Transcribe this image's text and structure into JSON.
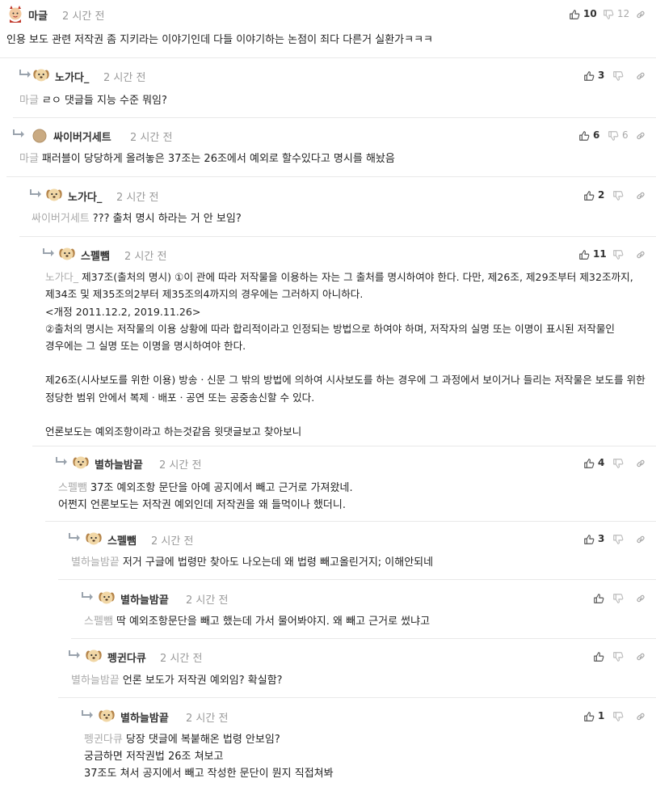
{
  "comments": [
    {
      "author": "마글",
      "time": "2 시간 전",
      "mention": "",
      "lines": [
        "인용 보도 관련 저작권 좀 지키라는 이야기인데 다들 이야기하는 논점이 죄다 다른거 실환가ㅋㅋㅋ"
      ],
      "up": "10",
      "down": "12",
      "avatar": "devil-avatar-icon"
    },
    {
      "author": "노가다_",
      "time": "2 시간 전",
      "mention": "마글",
      "lines": [
        "ㄹㅇ 댓글들 지능 수준 뭐임?"
      ],
      "up": "3",
      "down": "",
      "avatar": "puppy-avatar-icon"
    },
    {
      "author": "싸이버거세트",
      "time": "2 시간 전",
      "mention": "마글",
      "lines": [
        "패러블이 당당하게 올려놓은 37조는 26조에서 예외로 할수있다고 명시를 해놨음"
      ],
      "up": "6",
      "down": "6",
      "avatar": "round-avatar-icon"
    },
    {
      "author": "노가다_",
      "time": "2 시간 전",
      "mention": "싸이버거세트",
      "lines": [
        "??? 출처 명시 하라는 거 안 보임?"
      ],
      "up": "2",
      "down": "",
      "avatar": "puppy-avatar-icon"
    },
    {
      "author": "스펠뺌",
      "time": "2 시간 전",
      "mention": "노가다_",
      "lines": [
        "제37조(출처의 명시) ①이 관에 따라 저작물을 이용하는 자는 그 출처를 명시하여야 한다. 다만, 제26조, 제29조부터 제32조까지, 제34조 및 제35조의2부터 제35조의4까지의 경우에는 그러하지 아니하다.",
        "<개정 2011.12.2, 2019.11.26>",
        "②출처의 명시는 저작물의 이용 상황에 따라 합리적이라고 인정되는 방법으로 하여야 하며, 저작자의 실명 또는 이명이 표시된 저작물인 경우에는 그 실명 또는 이명을 명시하여야 한다.",
        "",
        "제26조(시사보도를 위한 이용) 방송ㆍ신문 그 밖의 방법에 의하여 시사보도를 하는 경우에 그 과정에서 보이거나 들리는 저작물은 보도를 위한 정당한 범위 안에서 복제ㆍ배포ㆍ공연 또는 공중송신할 수 있다.",
        "",
        "언론보도는 예외조항이라고 하는것같음 윗댓글보고 찾아보니"
      ],
      "up": "11",
      "down": "",
      "avatar": "puppy-avatar-icon"
    },
    {
      "author": "별하늘밤끝",
      "time": "2 시간 전",
      "mention": "스펠뺌",
      "lines": [
        "37조 예외조항 문단을 아예 공지에서 빼고 근거로 가져왔네.",
        "어쩐지 언론보도는 저작권 예외인데 저작권을 왜 들먹이나 했더니."
      ],
      "up": "4",
      "down": "",
      "avatar": "puppy-avatar-icon"
    },
    {
      "author": "스펠뺌",
      "time": "2 시간 전",
      "mention": "별하늘밤끝",
      "lines": [
        "저거 구글에 법령만 찾아도 나오는데 왜 법령 빼고올린거지; 이해안되네"
      ],
      "up": "3",
      "down": "",
      "avatar": "puppy-avatar-icon"
    },
    {
      "author": "별하늘밤끝",
      "time": "2 시간 전",
      "mention": "스펠뺌",
      "lines": [
        "딱 예외조항문단을 빼고 했는데 가서 물어봐야지. 왜 빼고 근거로 썼냐고"
      ],
      "up": "",
      "down": "",
      "avatar": "puppy-avatar-icon"
    },
    {
      "author": "펭귄다큐",
      "time": "2 시간 전",
      "mention": "별하늘밤끝",
      "lines": [
        "언론 보도가 저작권 예외임? 확실함?"
      ],
      "up": "",
      "down": "",
      "avatar": "puppy-avatar-icon"
    },
    {
      "author": "별하늘밤끝",
      "time": "2 시간 전",
      "mention": "펭귄다큐",
      "lines": [
        "당장 댓글에 복붙해온 법령 안보임?",
        "궁금하면 저작권법 26조 쳐보고",
        "37조도 쳐서 공지에서 빼고 작성한 문단이 뭔지 직접쳐봐"
      ],
      "up": "1",
      "down": "",
      "avatar": "puppy-avatar-icon"
    }
  ]
}
